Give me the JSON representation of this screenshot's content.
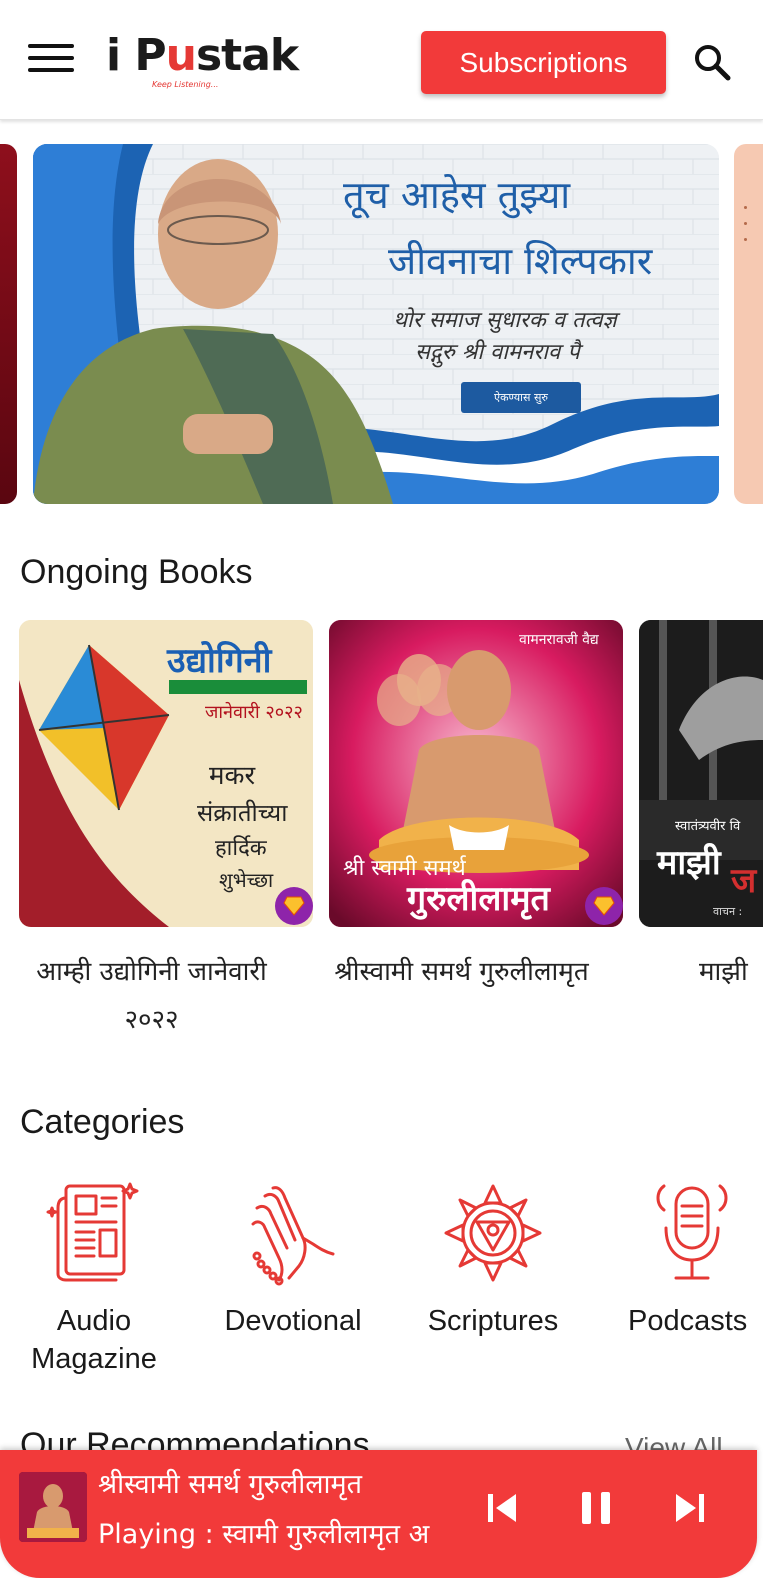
{
  "header": {
    "logo_main_1": "i P",
    "logo_u": "u",
    "logo_main_2": "stak",
    "logo_tagline": "Keep Listening...",
    "subscriptions_label": "Subscriptions",
    "icons": {
      "menu": "hamburger-menu-icon",
      "search": "search-icon"
    }
  },
  "banner": {
    "title_line1": "तूच आहेस तुझ्या",
    "title_line2": "जीवनाचा शिल्पकार",
    "subtitle_line1": "थोर समाज सुधारक व तत्वज्ञ",
    "subtitle_line2": "सद्गुरु श्री वामनराव पै",
    "cta": "ऐकण्यास सुरु"
  },
  "ongoing": {
    "title": "Ongoing Books",
    "books": [
      {
        "title": "आम्ही उद्योगिनी जानेवारी २०२२",
        "cover_heading": "उद्योगिनी",
        "cover_month": "जानेवारी २०२२",
        "cover_greeting_1": "मकर",
        "cover_greeting_2": "संक्रातीच्या",
        "cover_greeting_3": "हार्दिक",
        "cover_greeting_4": "शुभेच्छा"
      },
      {
        "title": "श्रीस्वामी समर्थ गुरुलीलामृत",
        "cover_author": "वामनरावजी वैद्य",
        "cover_line1": "श्री स्वामी समर्थ",
        "cover_line2": "गुरुलीलामृत"
      },
      {
        "title": "माझी",
        "cover_line1": "स्वातंत्र्यवीर वि",
        "cover_line2": "माझी",
        "cover_line3": "ज",
        "cover_reader": "वाचन :"
      }
    ]
  },
  "categories": {
    "title": "Categories",
    "items": [
      {
        "label_1": "Audio",
        "label_2": "Magazine",
        "icon": "magazine-icon"
      },
      {
        "label_1": "Devotional",
        "label_2": "",
        "icon": "praying-hands-icon"
      },
      {
        "label_1": "Scriptures",
        "label_2": "",
        "icon": "chakra-icon"
      },
      {
        "label_1": "Podcasts",
        "label_2": "",
        "icon": "microphone-icon"
      }
    ]
  },
  "recommendations": {
    "title": "Our Recommendations",
    "view_all": "View All"
  },
  "player": {
    "title": "श्रीस्वामी समर्थ गुरुलीलामृत",
    "status": "Playing : स्वामी गुरुलीलामृत अ",
    "icons": {
      "previous": "skip-previous-icon",
      "pause": "pause-icon",
      "next": "skip-next-icon"
    },
    "accent": "#f23a3a"
  },
  "colors": {
    "brand_red": "#f23a3a",
    "premium_badge": "#8e24aa",
    "banner_blue": "#1f5fa8"
  }
}
